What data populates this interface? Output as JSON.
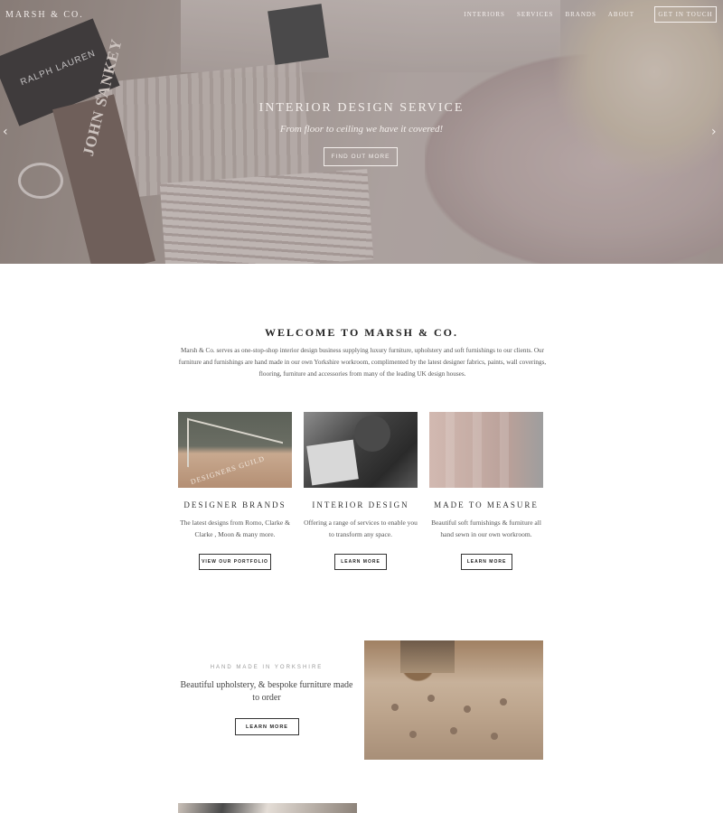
{
  "brand": {
    "logo": "MARSH & CO."
  },
  "nav": {
    "items": [
      "INTERIORS",
      "SERVICES",
      "BRANDS",
      "ABOUT"
    ],
    "cta": "GET IN TOUCH"
  },
  "hero": {
    "title": "INTERIOR DESIGN SERVICE",
    "subtitle": "From floor to ceiling we have it covered!",
    "button": "FIND OUT MORE",
    "image_text": {
      "spine": "JOHN SANKEY",
      "label": "RALPH LAUREN"
    }
  },
  "welcome": {
    "title": "WELCOME TO MARSH & CO.",
    "text": "Marsh & Co. serves as one-stop-shop interior design business supplying luxury furniture, upholstery and soft furnishings to our clients. Our furniture and furnishings are hand made in our own Yorkshire workroom, complimented by the latest designer fabrics, paints, wall coverings, flooring, furniture and accessories from many of the leading UK design houses."
  },
  "cards": [
    {
      "title": "DESIGNER BRANDS",
      "description": "The latest designs from Romo, Clarke & Clarke , Moon & many more.",
      "button": "VIEW OUR PORTFOLIO",
      "image_text": "DESIGNERS GUILD"
    },
    {
      "title": "INTERIOR DESIGN",
      "description": "Offering a range of services to enable you to transform any space.",
      "button": "LEARN MORE"
    },
    {
      "title": "MADE TO MEASURE",
      "description": "Beautiful soft furnishings & furniture all hand sewn in our own workroom.",
      "button": "LEARN MORE"
    }
  ],
  "handmade": {
    "kicker": "HAND MADE IN YORKSHIRE",
    "title": "Beautiful upholstery, & bespoke furniture made to order",
    "button": "LEARN MORE"
  },
  "icons": {
    "prev": "chevron-left-icon",
    "next": "chevron-right-icon"
  },
  "colors": {
    "hero_overlay": "#a89c95",
    "text_dark": "#222222",
    "text_body": "#555555",
    "kicker": "#9a9a9a"
  }
}
